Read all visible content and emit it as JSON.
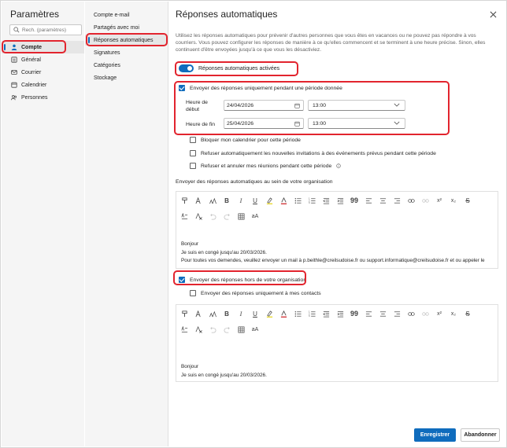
{
  "app_title": "Paramètres",
  "search": {
    "placeholder": "Rech. (paramètres)"
  },
  "nav": [
    {
      "label": "Compte",
      "icon": "person-icon"
    },
    {
      "label": "Général",
      "icon": "settings-icon"
    },
    {
      "label": "Courrier",
      "icon": "mail-icon"
    },
    {
      "label": "Calendrier",
      "icon": "calendar-icon"
    },
    {
      "label": "Personnes",
      "icon": "people-icon"
    }
  ],
  "subnav": [
    "Compte e-mail",
    "Partagés avec moi",
    "Réponses automatiques",
    "Signatures",
    "Catégories",
    "Stockage"
  ],
  "page": {
    "title": "Réponses automatiques",
    "description": "Utilisez les réponses automatiques pour prévenir d'autres personnes que vous êtes en vacances ou ne pouvez pas répondre à vos courriers. Vous pouvez configurer les réponses de manière à ce qu'elles commencent et se terminent à une heure précise. Sinon, elles continuent d'être envoyées jusqu'à ce que vous les désactiviez.",
    "toggle_label": "Réponses automatiques activées",
    "period_checkbox": "Envoyer des réponses uniquement pendant une période donnée",
    "start_label": "Heure de début",
    "start_date": "24/04/2026",
    "start_time": "13:00",
    "end_label": "Heure de fin",
    "end_date": "25/04/2026",
    "end_time": "13:00",
    "options": [
      "Bloquer mon calendrier pour cette période",
      "Refuser automatiquement les nouvelles invitations à des événements prévus pendant cette période",
      "Refuser et annuler mes réunions pendant cette période"
    ],
    "internal_title": "Envoyer des réponses automatiques au sein de votre organisation",
    "internal_body": [
      "Bonjour",
      "Je suis en congé jusqu'au 20/03/2026.",
      "Pour toutes vos demendes, veuillez envoyer un mail à p.beithle@creilsudoise.fr ou support.informatique@creilsudoise.fr et ou appeler le"
    ],
    "external_checkbox": "Envoyer des réponses hors de votre organisation",
    "contacts_checkbox": "Envoyer des réponses uniquement à mes contacts",
    "external_body": [
      "Bonjour",
      "Je suis en congé jusqu'au 20/03/2026."
    ],
    "save": "Enregistrer",
    "cancel": "Abandonner"
  },
  "toolbar_glyphs": {
    "superscript": "x²",
    "subscript": "x₂",
    "quote": "99",
    "font_size": "aA"
  },
  "colors": {
    "accent": "#0f6cbd",
    "highlight": "#e2242e"
  }
}
